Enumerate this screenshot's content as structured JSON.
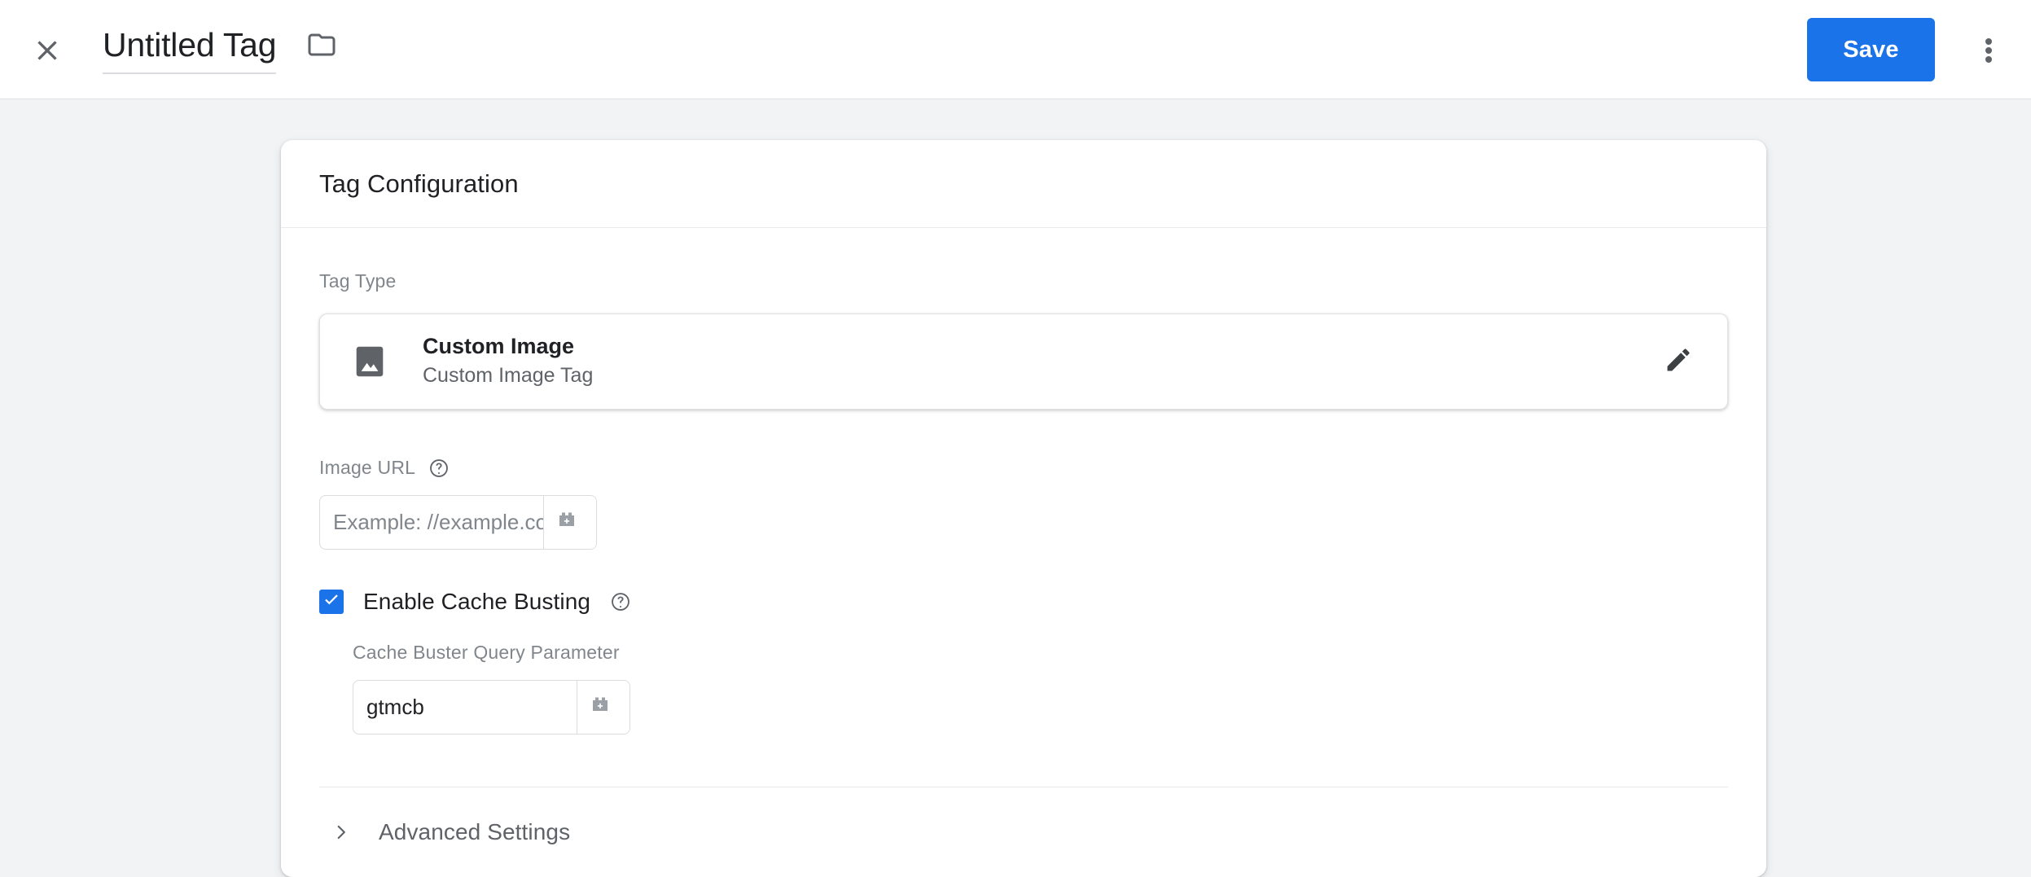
{
  "appbar": {
    "close_icon": "close-icon",
    "title": "Untitled Tag",
    "folder_icon": "folder-icon",
    "save_label": "Save",
    "more_icon": "more-vert-icon"
  },
  "card": {
    "header_title": "Tag Configuration",
    "tag_type": {
      "label": "Tag Type",
      "icon": "image-icon",
      "name": "Custom Image",
      "description": "Custom Image Tag",
      "edit_icon": "pencil-icon"
    },
    "image_url": {
      "label": "Image URL",
      "help_icon": "help-circle-icon",
      "value": "",
      "placeholder": "Example: //example.com/a.gif",
      "variable_icon": "add-variable-icon"
    },
    "cache_busting": {
      "checked": true,
      "label": "Enable Cache Busting",
      "help_icon": "help-circle-icon",
      "param_label": "Cache Buster Query Parameter",
      "param_value": "gtmcb",
      "param_placeholder": "",
      "variable_icon": "add-variable-icon"
    },
    "advanced": {
      "chevron_icon": "chevron-right-icon",
      "label": "Advanced Settings"
    }
  },
  "colors": {
    "accent": "#1a73e8",
    "page_background": "#f1f3f4",
    "surface": "#ffffff",
    "text_primary": "#202124",
    "text_secondary": "#5f6368",
    "text_muted": "#80868b",
    "border": "#dadce0"
  }
}
